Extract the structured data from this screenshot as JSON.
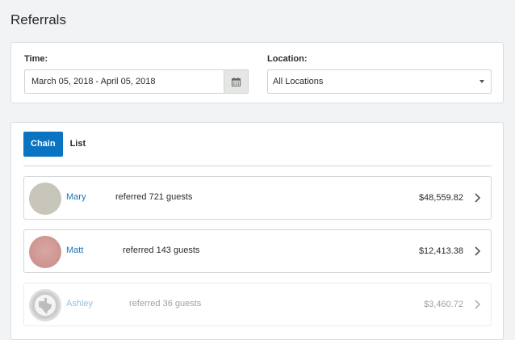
{
  "page": {
    "title": "Referrals"
  },
  "filters": {
    "time_label": "Time:",
    "date_range": "March 05, 2018 - April 05, 2018",
    "location_label": "Location:",
    "location_value": "All Locations"
  },
  "tabs": [
    {
      "label": "Chain",
      "active": true
    },
    {
      "label": "List",
      "active": false
    }
  ],
  "referrers": [
    {
      "name": "Mary",
      "referred_text": "referred 721 guests",
      "amount": "$48,559.82",
      "avatar_color": "#c8c6bb"
    },
    {
      "name": "Matt",
      "referred_text": "referred 143 guests",
      "amount": "$12,413.38",
      "avatar_color": "#d6a39f"
    },
    {
      "name": "Ashley",
      "referred_text": "referred 36 guests",
      "amount": "$3,460.72",
      "avatar_color": "#a9a9a9"
    }
  ],
  "colors": {
    "accent": "#0a73c2",
    "link": "#1a73b5",
    "background": "#f1f3f4"
  },
  "icons": {
    "calendar": "calendar-icon",
    "dropdown": "caret-down-icon",
    "row_action": "chevron-right-icon"
  }
}
